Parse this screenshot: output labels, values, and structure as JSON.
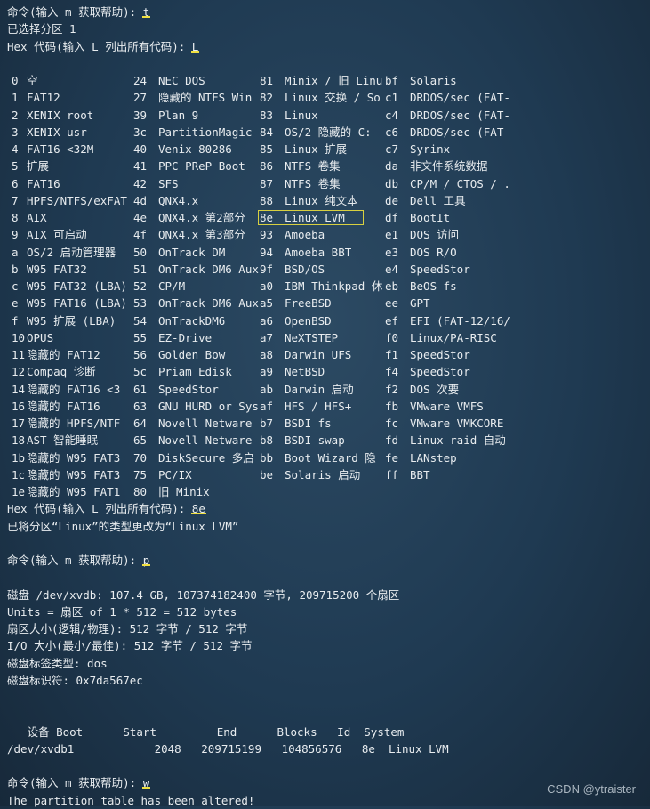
{
  "lines_top": {
    "cmd1_prefix": "命令(输入 m 获取帮助): ",
    "cmd1_input": "t",
    "selected": "已选择分区 1",
    "hex_prompt_prefix": "Hex 代码(输入 L 列出所有代码): ",
    "hex_prompt_input": "L"
  },
  "partition_types": [
    [
      [
        "0",
        "空"
      ],
      [
        "24",
        "NEC DOS"
      ],
      [
        "81",
        "Minix / 旧 Linu"
      ],
      [
        "bf",
        "Solaris"
      ]
    ],
    [
      [
        "1",
        "FAT12"
      ],
      [
        "27",
        "隐藏的 NTFS Win"
      ],
      [
        "82",
        "Linux 交换 / So"
      ],
      [
        "c1",
        "DRDOS/sec (FAT-"
      ]
    ],
    [
      [
        "2",
        "XENIX root"
      ],
      [
        "39",
        "Plan 9"
      ],
      [
        "83",
        "Linux"
      ],
      [
        "c4",
        "DRDOS/sec (FAT-"
      ]
    ],
    [
      [
        "3",
        "XENIX usr"
      ],
      [
        "3c",
        "PartitionMagic"
      ],
      [
        "84",
        "OS/2 隐藏的 C:"
      ],
      [
        "c6",
        "DRDOS/sec (FAT-"
      ]
    ],
    [
      [
        "4",
        "FAT16 <32M"
      ],
      [
        "40",
        "Venix 80286"
      ],
      [
        "85",
        "Linux 扩展"
      ],
      [
        "c7",
        "Syrinx"
      ]
    ],
    [
      [
        "5",
        "扩展"
      ],
      [
        "41",
        "PPC PReP Boot"
      ],
      [
        "86",
        "NTFS 卷集"
      ],
      [
        "da",
        "非文件系统数据"
      ]
    ],
    [
      [
        "6",
        "FAT16"
      ],
      [
        "42",
        "SFS"
      ],
      [
        "87",
        "NTFS 卷集"
      ],
      [
        "db",
        "CP/M / CTOS / ."
      ]
    ],
    [
      [
        "7",
        "HPFS/NTFS/exFAT"
      ],
      [
        "4d",
        "QNX4.x"
      ],
      [
        "88",
        "Linux 纯文本"
      ],
      [
        "de",
        "Dell 工具"
      ]
    ],
    [
      [
        "8",
        "AIX"
      ],
      [
        "4e",
        "QNX4.x 第2部分"
      ],
      [
        "8e",
        "Linux LVM"
      ],
      [
        "df",
        "BootIt"
      ]
    ],
    [
      [
        "9",
        "AIX 可启动"
      ],
      [
        "4f",
        "QNX4.x 第3部分"
      ],
      [
        "93",
        "Amoeba"
      ],
      [
        "e1",
        "DOS 访问"
      ]
    ],
    [
      [
        "a",
        "OS/2 启动管理器"
      ],
      [
        "50",
        "OnTrack DM"
      ],
      [
        "94",
        "Amoeba BBT"
      ],
      [
        "e3",
        "DOS R/O"
      ]
    ],
    [
      [
        "b",
        "W95 FAT32"
      ],
      [
        "51",
        "OnTrack DM6 Aux"
      ],
      [
        "9f",
        "BSD/OS"
      ],
      [
        "e4",
        "SpeedStor"
      ]
    ],
    [
      [
        "c",
        "W95 FAT32 (LBA)"
      ],
      [
        "52",
        "CP/M"
      ],
      [
        "a0",
        "IBM Thinkpad 休"
      ],
      [
        "eb",
        "BeOS fs"
      ]
    ],
    [
      [
        "e",
        "W95 FAT16 (LBA)"
      ],
      [
        "53",
        "OnTrack DM6 Aux"
      ],
      [
        "a5",
        "FreeBSD"
      ],
      [
        "ee",
        "GPT"
      ]
    ],
    [
      [
        "f",
        "W95 扩展 (LBA)"
      ],
      [
        "54",
        "OnTrackDM6"
      ],
      [
        "a6",
        "OpenBSD"
      ],
      [
        "ef",
        "EFI (FAT-12/16/"
      ]
    ],
    [
      [
        "10",
        "OPUS"
      ],
      [
        "55",
        "EZ-Drive"
      ],
      [
        "a7",
        "NeXTSTEP"
      ],
      [
        "f0",
        "Linux/PA-RISC"
      ]
    ],
    [
      [
        "11",
        "隐藏的 FAT12"
      ],
      [
        "56",
        "Golden Bow"
      ],
      [
        "a8",
        "Darwin UFS"
      ],
      [
        "f1",
        "SpeedStor"
      ]
    ],
    [
      [
        "12",
        "Compaq 诊断"
      ],
      [
        "5c",
        "Priam Edisk"
      ],
      [
        "a9",
        "NetBSD"
      ],
      [
        "f4",
        "SpeedStor"
      ]
    ],
    [
      [
        "14",
        "隐藏的 FAT16 <3"
      ],
      [
        "61",
        "SpeedStor"
      ],
      [
        "ab",
        "Darwin 启动"
      ],
      [
        "f2",
        "DOS 次要"
      ]
    ],
    [
      [
        "16",
        "隐藏的 FAT16"
      ],
      [
        "63",
        "GNU HURD or Sys"
      ],
      [
        "af",
        "HFS / HFS+"
      ],
      [
        "fb",
        "VMware VMFS"
      ]
    ],
    [
      [
        "17",
        "隐藏的 HPFS/NTF"
      ],
      [
        "64",
        "Novell Netware"
      ],
      [
        "b7",
        "BSDI fs"
      ],
      [
        "fc",
        "VMware VMKCORE"
      ]
    ],
    [
      [
        "18",
        "AST 智能睡眠"
      ],
      [
        "65",
        "Novell Netware"
      ],
      [
        "b8",
        "BSDI swap"
      ],
      [
        "fd",
        "Linux raid 自动"
      ]
    ],
    [
      [
        "1b",
        "隐藏的 W95 FAT3"
      ],
      [
        "70",
        "DiskSecure 多启"
      ],
      [
        "bb",
        "Boot Wizard 隐"
      ],
      [
        "fe",
        "LANstep"
      ]
    ],
    [
      [
        "1c",
        "隐藏的 W95 FAT3"
      ],
      [
        "75",
        "PC/IX"
      ],
      [
        "be",
        "Solaris 启动"
      ],
      [
        "ff",
        "BBT"
      ]
    ],
    [
      [
        "1e",
        "隐藏的 W95 FAT1"
      ],
      [
        "80",
        "旧 Minix"
      ]
    ]
  ],
  "lines_bottom": {
    "hex2_prefix": "Hex 代码(输入 L 列出所有代码): ",
    "hex2_input": "8e",
    "changed": "已将分区“Linux”的类型更改为“Linux LVM”",
    "cmd2_prefix": "命令(输入 m 获取帮助): ",
    "cmd2_input": "p",
    "disk": "磁盘 /dev/xvdb: 107.4 GB, 107374182400 字节, 209715200 个扇区",
    "units": "Units = 扇区 of 1 * 512 = 512 bytes",
    "sector": "扇区大小(逻辑/物理): 512 字节 / 512 字节",
    "io": "I/O 大小(最小/最佳): 512 字节 / 512 字节",
    "label": "磁盘标签类型: dos",
    "ident": "磁盘标识符: 0x7da567ec",
    "table_header": "   设备 Boot      Start         End      Blocks   Id  System",
    "table_row": "/dev/xvdb1            2048   209715199   104856576   8e  Linux LVM",
    "cmd3_prefix": "命令(输入 m 获取帮助): ",
    "cmd3_input": "w",
    "altered": "The partition table has been altered!"
  },
  "watermark": "CSDN @ytraister",
  "highlight_color": "#f0e040"
}
